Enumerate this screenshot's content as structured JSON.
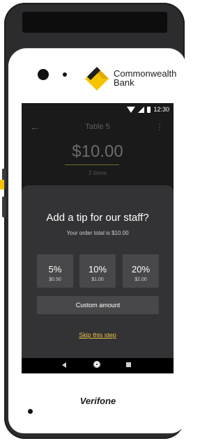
{
  "brand": {
    "bank_name": "Commonwealth\nBank",
    "bank_line1": "Commonwealth",
    "bank_line2": "Bank",
    "device_maker": "Verifone",
    "logo_color": "#f4c400"
  },
  "status_bar": {
    "time": "12:30",
    "icons": [
      "wifi-icon",
      "cell-signal-icon",
      "battery-icon"
    ]
  },
  "app_bar": {
    "title": "Table 5",
    "back_icon": "back-arrow-icon",
    "menu_icon": "more-vert-icon"
  },
  "order": {
    "amount": "$10.00",
    "items": "2 items"
  },
  "tip_sheet": {
    "title": "Add a tip for our staff?",
    "subtitle": "Your order total is $10.00",
    "options": [
      {
        "percent": "5%",
        "amount": "$0.50"
      },
      {
        "percent": "10%",
        "amount": "$1.00"
      },
      {
        "percent": "20%",
        "amount": "$2.00"
      }
    ],
    "custom_label": "Custom amount",
    "skip_label": "Skip this step",
    "accent_color": "#e8c04a"
  },
  "nav_bar": {
    "icons": [
      "nav-back-icon",
      "nav-home-icon",
      "nav-recents-icon"
    ]
  }
}
